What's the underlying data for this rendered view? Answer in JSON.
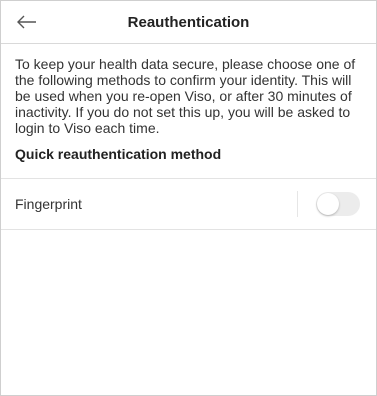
{
  "header": {
    "title": "Reauthentication",
    "back_icon": "arrow-left-icon"
  },
  "intro_text": "To keep your health data secure, please choose one of the following methods to confirm your identity. This will be used when you re-open Viso, or after 30 minutes of inactivity. If you do not set this up, you will be asked to login to Viso each time.",
  "section": {
    "heading": "Quick reauthentication method"
  },
  "options": [
    {
      "label": "Fingerprint",
      "enabled": false
    }
  ],
  "colors": {
    "divider": "#e3e3e3",
    "toggle_off": "#ececec"
  }
}
